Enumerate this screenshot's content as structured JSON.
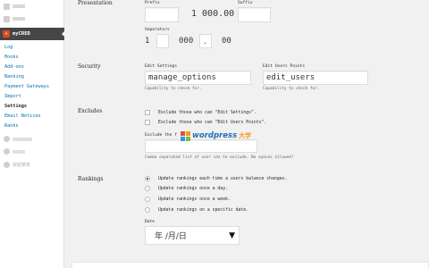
{
  "sidebar": {
    "top_items": [
      {
        "label": "工具",
        "icon": "tools-icon"
      },
      {
        "label": "设置",
        "icon": "settings-icon"
      }
    ],
    "plugin": {
      "label": "myCRED",
      "icon": "mycred-logo-icon"
    },
    "submenu": [
      "Log",
      "Hooks",
      "Add-ons",
      "Banking",
      "Payment Gateways",
      "Import",
      "Settings",
      "Email Notices",
      "Ranks"
    ],
    "active_item": "Settings",
    "bottom_items": [
      {
        "label": "",
        "icon": "plugin-icon"
      },
      {
        "label": "",
        "icon": "plugin-icon"
      },
      {
        "label": "收起菜单",
        "icon": "collapse-icon"
      }
    ]
  },
  "presentation": {
    "label": "Presentation",
    "prefix_label": "Prefix",
    "prefix_value": "",
    "amount": "1 000.00",
    "suffix_label": "Suffix",
    "suffix_value": "",
    "separators_label": "Separators",
    "sep_one": "1",
    "sep_thousands": "",
    "sep_zeros": "000",
    "sep_decimal": ".",
    "sep_decimals": "00"
  },
  "security": {
    "label": "Security",
    "edit_settings_label": "Edit Settings",
    "edit_settings_value": "manage_options",
    "edit_settings_desc": "Capability to check for.",
    "edit_users_label": "Edit Users Points",
    "edit_users_value": "edit_users",
    "edit_users_desc": "Capability to check for."
  },
  "excludes": {
    "label": "Excludes",
    "option_1": "Exclude those who can \"Edit Settings\".",
    "option_2": "Exclude those who can \"Edit Users Points\".",
    "list_label": "Exclude the f",
    "list_value": "",
    "list_desc": "Comma separated list of user ids to exclude. No spaces allowed!"
  },
  "watermark": {
    "brand": "wordpress",
    "cn": "大学"
  },
  "rankings": {
    "label": "Rankings",
    "options": [
      "Update rankings each time a users balance changes.",
      "Update rankings once a day.",
      "Update rankings once a week.",
      "Update rankings on a specific date."
    ],
    "selected_index": 0,
    "date_label": "Date",
    "date_placeholder": "年 /月/日"
  }
}
